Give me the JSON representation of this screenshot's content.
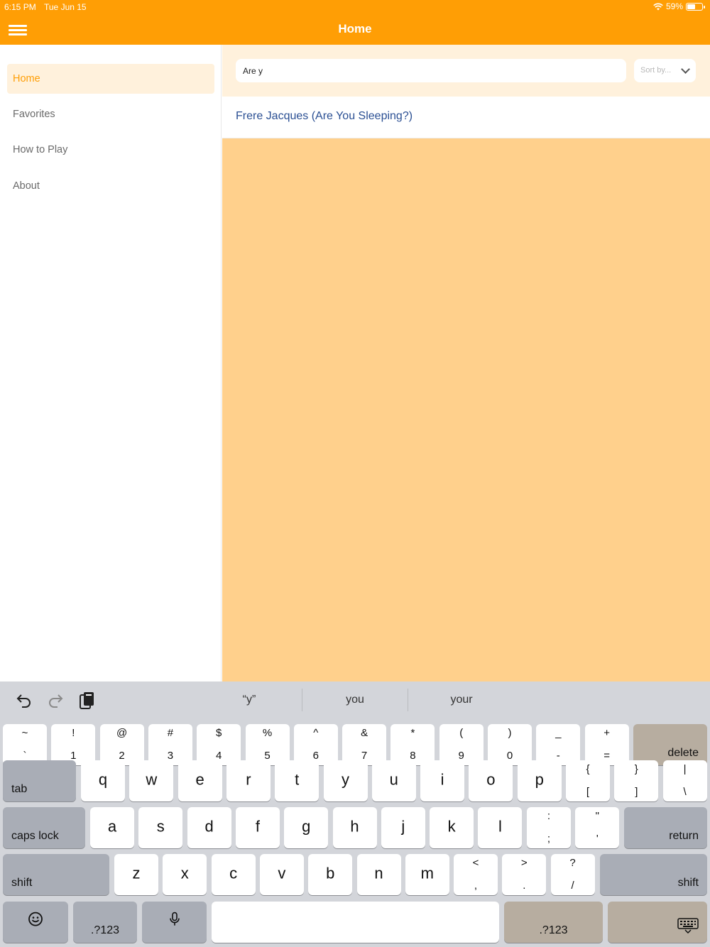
{
  "status": {
    "time": "6:15 PM",
    "date": "Tue Jun 15",
    "battery": "59%",
    "battery_level": 0.59
  },
  "header": {
    "title": "Home"
  },
  "sidebar": {
    "items": [
      {
        "label": "Home"
      },
      {
        "label": "Favorites"
      },
      {
        "label": "How to Play"
      },
      {
        "label": "About"
      }
    ]
  },
  "search": {
    "value": "Are y",
    "sort_placeholder": "Sort by..."
  },
  "results": [
    {
      "title": "Frere Jacques (Are You Sleeping?)"
    }
  ],
  "keyboard": {
    "suggestions": [
      "“y”",
      "you",
      "your"
    ],
    "row_numbers": [
      {
        "top": "~",
        "bot": "`"
      },
      {
        "top": "!",
        "bot": "1"
      },
      {
        "top": "@",
        "bot": "2"
      },
      {
        "top": "#",
        "bot": "3"
      },
      {
        "top": "$",
        "bot": "4"
      },
      {
        "top": "%",
        "bot": "5"
      },
      {
        "top": "^",
        "bot": "6"
      },
      {
        "top": "&",
        "bot": "7"
      },
      {
        "top": "*",
        "bot": "8"
      },
      {
        "top": "(",
        "bot": "9"
      },
      {
        "top": ")",
        "bot": "0"
      },
      {
        "top": "_",
        "bot": "-"
      },
      {
        "top": "+",
        "bot": "="
      }
    ],
    "row_q": [
      "q",
      "w",
      "e",
      "r",
      "t",
      "y",
      "u",
      "i",
      "o",
      "p"
    ],
    "row_q_symbols": [
      {
        "top": "{",
        "bot": "["
      },
      {
        "top": "}",
        "bot": "]"
      },
      {
        "top": "|",
        "bot": "\\"
      }
    ],
    "row_a": [
      "a",
      "s",
      "d",
      "f",
      "g",
      "h",
      "j",
      "k",
      "l"
    ],
    "row_a_symbols": [
      {
        "top": ":",
        "bot": ";"
      },
      {
        "top": "\"",
        "bot": "'"
      }
    ],
    "row_z": [
      "z",
      "x",
      "c",
      "v",
      "b",
      "n",
      "m"
    ],
    "row_z_symbols": [
      {
        "top": "<",
        "bot": ","
      },
      {
        "top": ">",
        "bot": "."
      },
      {
        "top": "?",
        "bot": "/"
      }
    ],
    "labels": {
      "delete": "delete",
      "tab": "tab",
      "caps": "caps lock",
      "return": "return",
      "shift": "shift",
      "num_left": ".?123",
      "num_right": ".?123"
    }
  }
}
